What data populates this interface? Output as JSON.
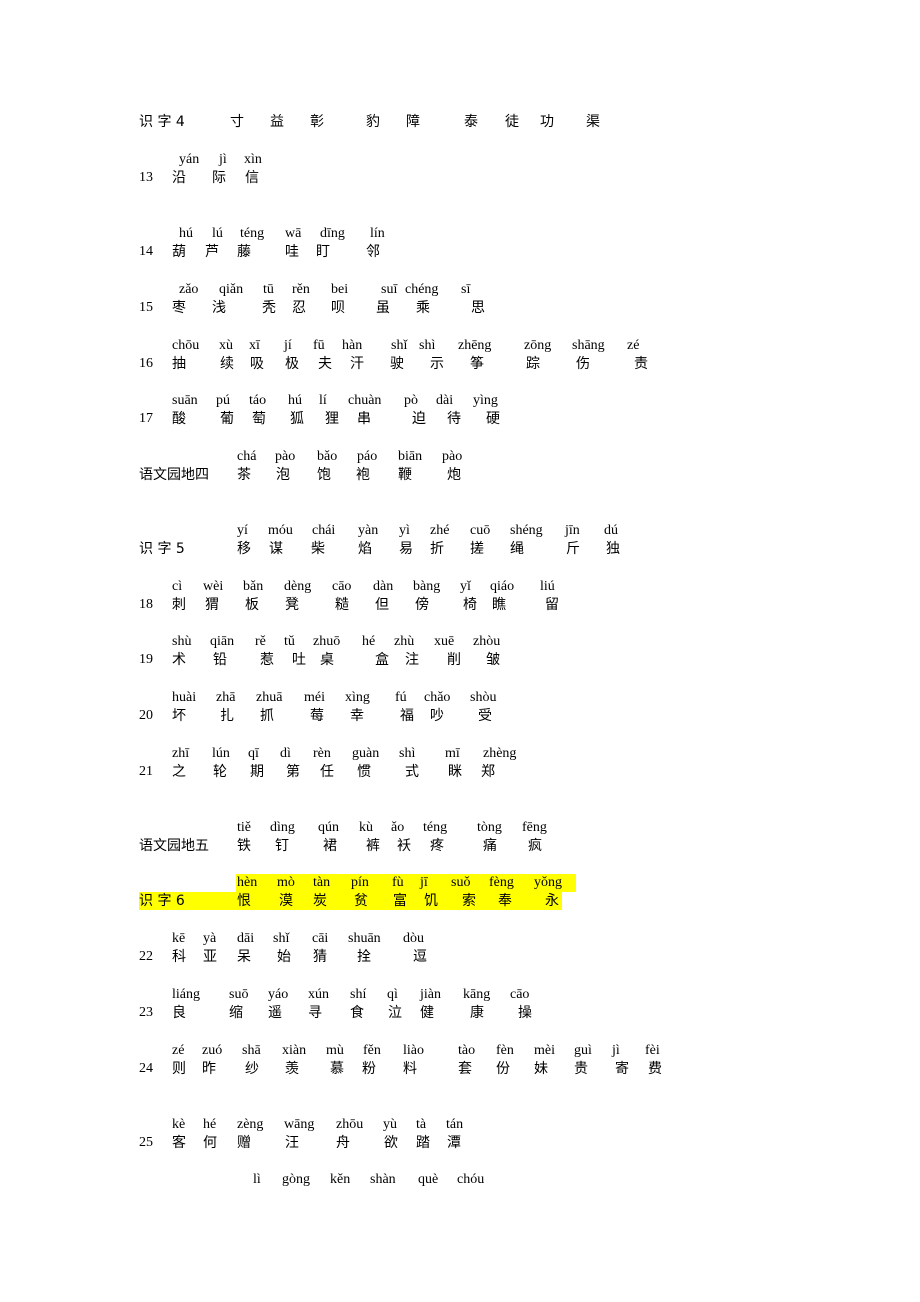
{
  "highlight_color": "#ffff00",
  "sections": [
    {
      "id": "s4",
      "label": "识 字 4",
      "pinyin": [],
      "chars": [
        "寸",
        "益",
        "彰",
        "豹",
        "障",
        "泰",
        "徒",
        "功",
        "渠"
      ]
    },
    {
      "id": "l13",
      "label": "13",
      "pinyin": [
        "yán",
        "jì",
        "xìn"
      ],
      "chars": [
        "沿",
        "际",
        "信"
      ]
    },
    {
      "id": "l14",
      "label": "14",
      "pinyin": [
        "hú",
        "lú",
        "téng",
        "wā",
        "dīng",
        "lín"
      ],
      "chars": [
        "葫",
        "芦",
        "藤",
        "哇",
        "盯",
        "邻"
      ]
    },
    {
      "id": "l15",
      "label": "15",
      "pinyin": [
        "zǎo",
        "qiǎn",
        "tū",
        "rěn",
        "bei",
        "suī",
        "chéng",
        "sī"
      ],
      "chars": [
        "枣",
        "浅",
        "秃",
        "忍",
        "呗",
        "虽",
        "乘",
        "思"
      ]
    },
    {
      "id": "l16",
      "label": "16",
      "pinyin": [
        "chōu",
        "xù",
        "xī",
        "jí",
        "fū",
        "hàn",
        "shǐ",
        "shì",
        "zhēng",
        "zōng",
        "shāng",
        "zé"
      ],
      "chars": [
        "抽",
        "续",
        "吸",
        "极",
        "夫",
        "汗",
        "驶",
        "示",
        "筝",
        "踪",
        "伤",
        "责"
      ]
    },
    {
      "id": "l17",
      "label": "17",
      "pinyin": [
        "suān",
        "pú",
        "táo",
        "hú",
        "lí",
        "chuàn",
        "pò",
        "dài",
        "yìng"
      ],
      "chars": [
        "酸",
        "葡",
        "萄",
        "狐",
        "狸",
        "串",
        "迫",
        "待",
        "硬"
      ]
    },
    {
      "id": "yw4",
      "label": "语文园地四",
      "pinyin": [
        "chá",
        "pào",
        "bǎo",
        "páo",
        "biān",
        "pào"
      ],
      "chars": [
        "茶",
        "泡",
        "饱",
        "袍",
        "鞭",
        "炮"
      ]
    },
    {
      "id": "s5",
      "label": "识 字 5",
      "pinyin": [
        "yí",
        "móu",
        "chái",
        "yàn",
        "yì",
        "zhé",
        "cuō",
        "shéng",
        "jīn",
        "dú"
      ],
      "chars": [
        "移",
        "谋",
        "柴",
        "焰",
        "易",
        "折",
        "搓",
        "绳",
        "斤",
        "独"
      ]
    },
    {
      "id": "l18",
      "label": "18",
      "pinyin": [
        "cì",
        "wèi",
        "bǎn",
        "dèng",
        "cāo",
        "dàn",
        "bàng",
        "yǐ",
        "qiáo",
        "liú"
      ],
      "chars": [
        "刺",
        "猬",
        "板",
        "凳",
        "糙",
        "但",
        "傍",
        "椅",
        "瞧",
        "留"
      ]
    },
    {
      "id": "l19",
      "label": "19",
      "pinyin": [
        "shù",
        "qiān",
        "rě",
        "tǔ",
        "zhuō",
        "hé",
        "zhù",
        "xuē",
        "zhòu"
      ],
      "chars": [
        "术",
        "铅",
        "惹",
        "吐",
        "桌",
        "盒",
        "注",
        "削",
        "皱"
      ]
    },
    {
      "id": "l20",
      "label": "20",
      "pinyin": [
        "huài",
        "zhā",
        "zhuā",
        "méi",
        "xìng",
        "fú",
        "chǎo",
        "shòu"
      ],
      "chars": [
        "坏",
        "扎",
        "抓",
        "莓",
        "幸",
        "福",
        "吵",
        "受"
      ]
    },
    {
      "id": "l21",
      "label": "21",
      "pinyin": [
        "zhī",
        "lún",
        "qī",
        "dì",
        "rèn",
        "guàn",
        "shì",
        "mī",
        "zhèng"
      ],
      "chars": [
        "之",
        "轮",
        "期",
        "第",
        "任",
        "惯",
        "式",
        "眯",
        "郑"
      ]
    },
    {
      "id": "yw5",
      "label": "语文园地五",
      "pinyin": [
        "tiě",
        "dìng",
        "qún",
        "kù",
        "ǎo",
        "téng",
        "tòng",
        "fēng"
      ],
      "chars": [
        "铁",
        "钉",
        "裙",
        "裤",
        "袄",
        "疼",
        "痛",
        "疯"
      ]
    },
    {
      "id": "s6",
      "label": "识 字 6",
      "highlighted": true,
      "pinyin": [
        "hèn",
        "mò",
        "tàn",
        "pín",
        "fù",
        "jī",
        "suǒ",
        "fèng",
        "yǒng"
      ],
      "chars": [
        "恨",
        "漠",
        "炭",
        "贫",
        "富",
        "饥",
        "索",
        "奉",
        "永"
      ]
    },
    {
      "id": "l22",
      "label": "22",
      "pinyin": [
        "kē",
        "yà",
        "dāi",
        "shǐ",
        "cāi",
        "shuān",
        "dòu"
      ],
      "chars": [
        "科",
        "亚",
        "呆",
        "始",
        "猜",
        "拴",
        "逗"
      ]
    },
    {
      "id": "l23",
      "label": "23",
      "pinyin": [
        "liáng",
        "suō",
        "yáo",
        "xún",
        "shí",
        "qì",
        "jiàn",
        "kāng",
        "cāo"
      ],
      "chars": [
        "良",
        "缩",
        "遥",
        "寻",
        "食",
        "泣",
        "健",
        "康",
        "操"
      ]
    },
    {
      "id": "l24",
      "label": "24",
      "pinyin": [
        "zé",
        "zuó",
        "shā",
        "xiàn",
        "mù",
        "fěn",
        "liào",
        "tào",
        "fèn",
        "mèi",
        "guì",
        "jì",
        "fèi"
      ],
      "chars": [
        "则",
        "昨",
        "纱",
        "羡",
        "慕",
        "粉",
        "料",
        "套",
        "份",
        "妹",
        "贵",
        "寄",
        "费"
      ]
    },
    {
      "id": "l25",
      "label": "25",
      "pinyin": [
        "kè",
        "hé",
        "zèng",
        "wāng",
        "zhōu",
        "yù",
        "tà",
        "tán"
      ],
      "chars": [
        "客",
        "何",
        "赠",
        "汪",
        "舟",
        "欲",
        "踏",
        "潭"
      ]
    },
    {
      "id": "l26",
      "label": "",
      "pinyin": [
        "lì",
        "gòng",
        "kěn",
        "shàn",
        "què",
        "chóu"
      ],
      "chars": []
    }
  ]
}
